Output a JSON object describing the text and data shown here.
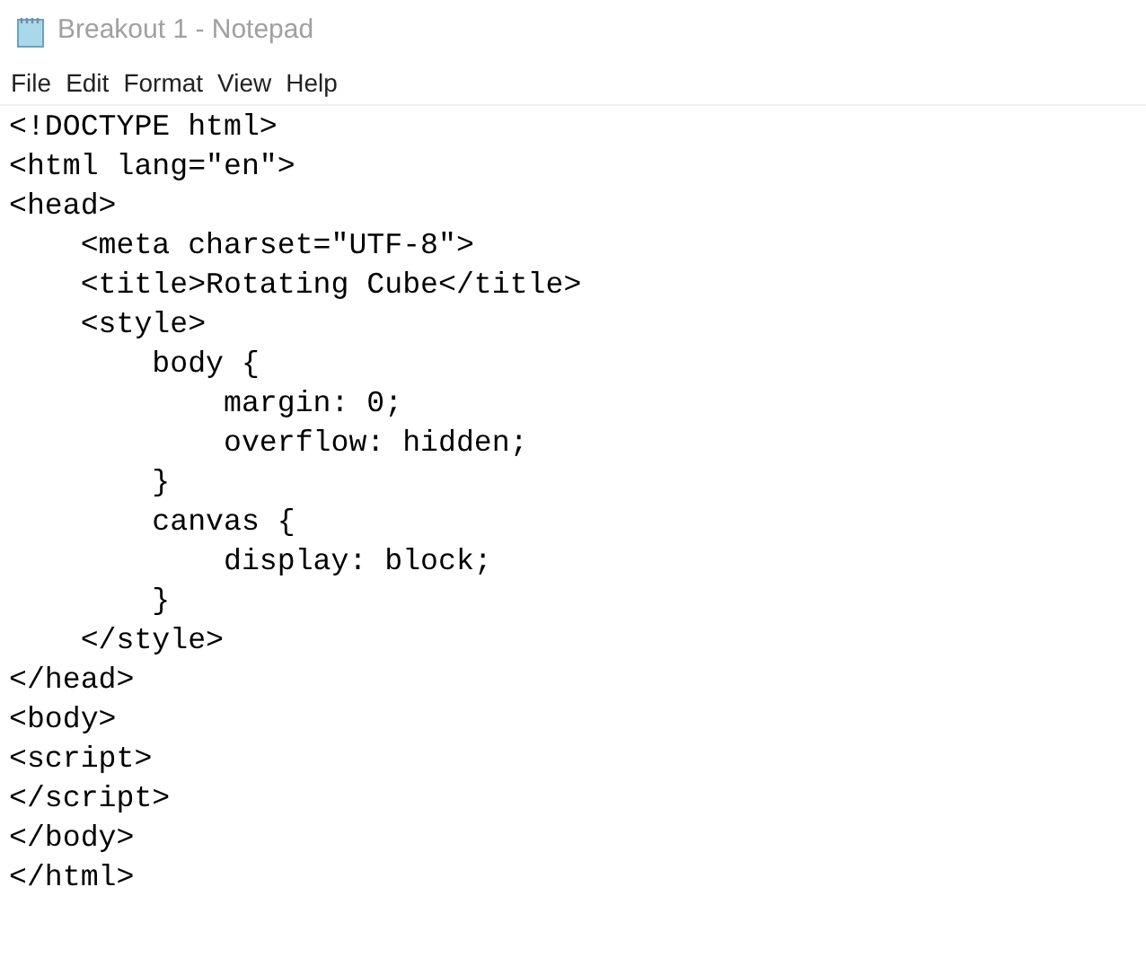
{
  "window": {
    "title": "Breakout 1 - Notepad"
  },
  "menu": [
    "File",
    "Edit",
    "Format",
    "View",
    "Help"
  ],
  "editor": {
    "lines": [
      "<!DOCTYPE html>",
      "<html lang=\"en\">",
      "<head>",
      "    <meta charset=\"UTF-8\">",
      "    <title>Rotating Cube</title>",
      "    <style>",
      "        body {",
      "            margin: 0;",
      "            overflow: hidden;",
      "        }",
      "        canvas {",
      "            display: block;",
      "        }",
      "    </style>",
      "</head>",
      "<body>",
      "<script>",
      "</script>",
      "</body>",
      "</html>"
    ]
  }
}
